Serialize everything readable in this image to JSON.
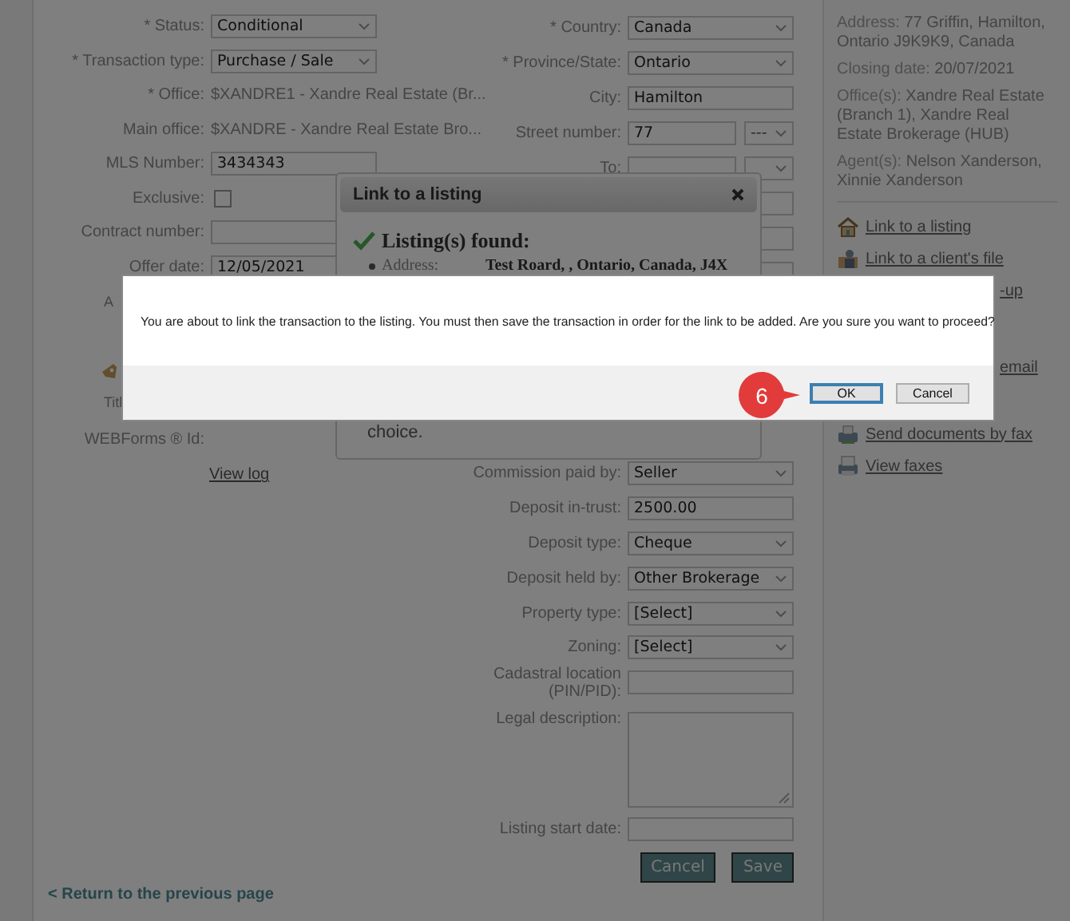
{
  "form": {
    "left_upper": [
      {
        "kind": "select",
        "label": "* Status:",
        "value": "Conditional"
      },
      {
        "kind": "select",
        "label": "* Transaction type:",
        "value": "Purchase / Sale"
      },
      {
        "kind": "text",
        "label": "* Office:",
        "value": "$XANDRE1 - Xandre Real Estate (Br..."
      },
      {
        "kind": "text",
        "label": "Main office:",
        "value": "$XANDRE - Xandre Real Estate Bro..."
      },
      {
        "kind": "input",
        "label": "MLS Number:",
        "value": "3434343"
      },
      {
        "kind": "checkbox",
        "label": "Exclusive:",
        "checked": false
      },
      {
        "kind": "input",
        "label": "Contract number:"
      },
      {
        "kind": "input",
        "label": "Offer date:",
        "value": "12/05/2021"
      }
    ],
    "left_lower": {
      "cut_label": "A",
      "cut_title_label": "Titl",
      "webforms_label": "WEBForms ® Id:",
      "view_log_link": "View log"
    },
    "right_upper": [
      {
        "kind": "select",
        "label": "* Country:",
        "value": "Canada"
      },
      {
        "kind": "select",
        "label": "* Province/State:",
        "value": "Ontario"
      },
      {
        "kind": "input",
        "label": "City:",
        "value": "Hamilton"
      },
      {
        "kind": "input_select",
        "label": "Street number:",
        "value": "77",
        "select_value": "---"
      },
      {
        "kind": "input_select",
        "label": "To:"
      },
      {
        "kind": "input"
      },
      {
        "kind": "input"
      },
      {
        "kind": "input"
      }
    ],
    "right_lower": [
      {
        "kind": "select",
        "label": "Commission paid by:",
        "value": "Seller"
      },
      {
        "kind": "input",
        "label": "Deposit in-trust:",
        "value": "2500.00"
      },
      {
        "kind": "select",
        "label": "Deposit type:",
        "value": "Cheque"
      },
      {
        "kind": "select",
        "label": "Deposit held by:",
        "value": "Other Brokerage"
      },
      {
        "kind": "select",
        "label": "Property type:",
        "value": "[Select]"
      },
      {
        "kind": "select",
        "label": "Zoning:",
        "value": "[Select]"
      },
      {
        "kind": "input",
        "label": "Cadastral location (PIN/PID):"
      },
      {
        "kind": "textarea",
        "label": "Legal description:"
      },
      {
        "kind": "input",
        "label": "Listing start date:"
      }
    ],
    "buttons": [
      "Cancel",
      "Save"
    ],
    "return_link": "< Return to the previous page"
  },
  "sidebar": {
    "info": [
      {
        "label": "Address:",
        "value": "77 Griffin, Hamilton, Ontario J9K9K9, Canada"
      },
      {
        "label": "Closing date:",
        "value": "20/07/2021"
      },
      {
        "label": "Office(s):",
        "value": "Xandre Real Estate (Branch 1), Xandre Real Estate Brokerage (HUB)"
      },
      {
        "label": "Agent(s):",
        "value": "Nelson Xanderson, Xinnie Xanderson"
      }
    ],
    "link_groups": [
      [
        {
          "kind": "with_icon",
          "text": "Link to a listing"
        },
        {
          "kind": "with_icon",
          "text": "Link to a client's file"
        },
        {
          "kind": "text_only",
          "text": "-up"
        }
      ],
      [
        {
          "kind": "text_only",
          "text": "email"
        }
      ],
      [
        {
          "kind": "with_icon",
          "text": "Send documents by fax"
        },
        {
          "kind": "with_icon",
          "text": "View faxes"
        }
      ]
    ]
  },
  "listing_dialog": {
    "title": "Link to a listing",
    "heading": "Listing(s) found:",
    "address_label": "Address:",
    "address_value": "Test Roard, , Ontario, Canada, J4X",
    "trailing_text": "choice."
  },
  "confirm_dialog": {
    "message": "You are about to link the transaction to the listing. You must then save the transaction in order for the link to be added. Are you sure you want to proceed?",
    "buttons": [
      {
        "label": "OK",
        "selected": true
      },
      {
        "label": "Cancel",
        "selected": false
      }
    ]
  },
  "callout": {
    "number": "6"
  }
}
